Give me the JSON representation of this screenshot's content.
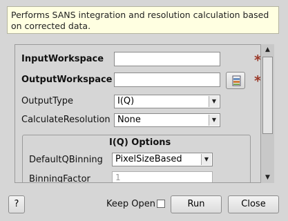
{
  "description": "Performs SANS integration and resolution calculation based on corrected data.",
  "properties": {
    "input_workspace": {
      "label": "InputWorkspace",
      "value": ""
    },
    "output_workspace": {
      "label": "OutputWorkspace",
      "value": ""
    },
    "output_type": {
      "label": "OutputType",
      "value": "I(Q)"
    },
    "calculate_resolution": {
      "label": "CalculateResolution",
      "value": "None"
    }
  },
  "iq_options": {
    "title": "I(Q) Options",
    "default_q_binning": {
      "label": "DefaultQBinning",
      "value": "PixelSizeBased"
    },
    "binning_factor": {
      "label": "BinningFactor",
      "value": "1"
    }
  },
  "footer": {
    "help_label": "?",
    "keep_open_label": "Keep Open",
    "keep_open_checked": false,
    "run_label": "Run",
    "close_label": "Close"
  },
  "required_marker": "*",
  "icons": {
    "browse": "workspace-browse-icon",
    "dropdown": "chevron-down-icon"
  }
}
